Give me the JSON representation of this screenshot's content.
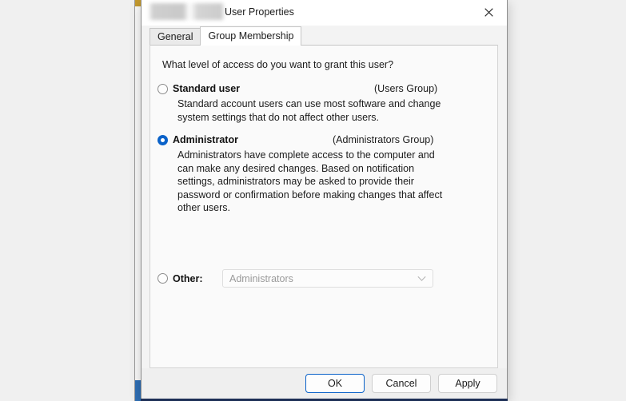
{
  "window": {
    "title": "User Properties",
    "title_redacted": true,
    "close_icon": "close-icon"
  },
  "tabs": [
    {
      "label": "General",
      "active": false
    },
    {
      "label": "Group Membership",
      "active": true
    }
  ],
  "content": {
    "prompt": "What level of access do you want to grant this user?",
    "options": [
      {
        "label": "Standard user",
        "group": "(Users Group)",
        "description": "Standard account users can use most software and change system settings that do not affect other users.",
        "selected": false
      },
      {
        "label": "Administrator",
        "group": "(Administrators Group)",
        "description": "Administrators have complete access to the computer and can make any desired changes. Based on notification settings, administrators may be asked to provide their password or confirmation before making changes that affect other users.",
        "selected": true
      }
    ],
    "other": {
      "label": "Other:",
      "selected": false,
      "combo_value": "Administrators",
      "combo_disabled": true,
      "chevron_icon": "chevron-down-icon"
    }
  },
  "footer": {
    "ok_label": "OK",
    "cancel_label": "Cancel",
    "apply_label": "Apply"
  },
  "colors": {
    "accent": "#0a62c9",
    "dialog_background": "#f3f3f3",
    "panel_background": "#fafafa",
    "desktop_background": "#f0f0f0"
  }
}
